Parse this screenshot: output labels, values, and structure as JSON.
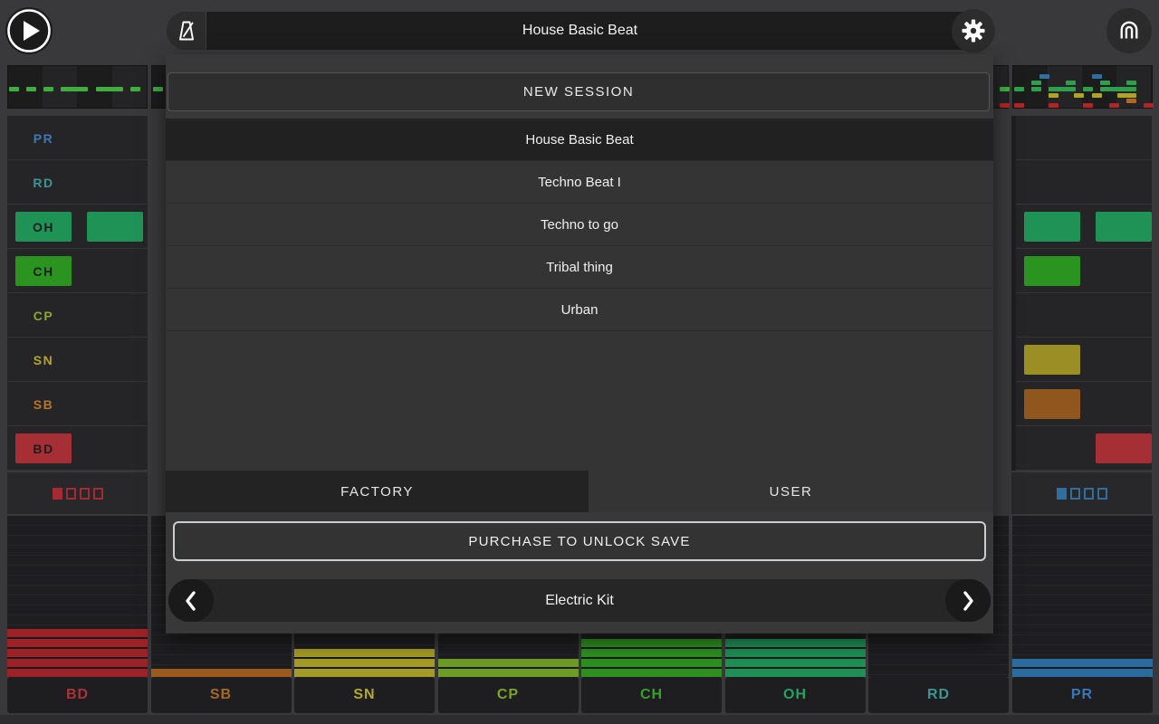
{
  "top_bar": {
    "title": "House Basic Beat",
    "play_icon": "play-icon",
    "metronome_icon": "metronome-icon",
    "settings_icon": "gear-icon",
    "logo_icon": "fingerlab-logo-icon"
  },
  "modal": {
    "new_session_label": "NEW SESSION",
    "sessions": [
      {
        "name": "House Basic Beat",
        "selected": true
      },
      {
        "name": "Techno Beat I",
        "selected": false
      },
      {
        "name": "Techno to go",
        "selected": false
      },
      {
        "name": "Tribal thing",
        "selected": false
      },
      {
        "name": "Urban",
        "selected": false
      }
    ],
    "tabs": [
      {
        "label": "FACTORY",
        "active": true
      },
      {
        "label": "USER",
        "active": false
      }
    ],
    "purchase_label": "PURCHASE TO UNLOCK SAVE",
    "kit_selector": {
      "value": "Electric Kit",
      "left_icon": "chevron-left-icon",
      "right_icon": "chevron-right-icon"
    }
  },
  "tracks": [
    {
      "id": "PR",
      "label": "PR",
      "text_color": "#3c78b4",
      "pad_color": "#2f6ba5",
      "left_col1_pad": false,
      "left_col2_pad": false,
      "right_col1_pad": false,
      "right_col2_pad": false
    },
    {
      "id": "RD",
      "label": "RD",
      "text_color": "#3d9494",
      "pad_color": "#2e8a8a",
      "left_col1_pad": false,
      "left_col2_pad": false,
      "right_col1_pad": false,
      "right_col2_pad": false
    },
    {
      "id": "OH",
      "label": "OH",
      "text_color": "#27a061",
      "pad_color": "#1f9356",
      "left_col1_pad": true,
      "left_col2_pad": true,
      "right_col1_pad": true,
      "right_col2_pad": true
    },
    {
      "id": "CH",
      "label": "CH",
      "text_color": "#39a02c",
      "pad_color": "#2b9320",
      "left_col1_pad": true,
      "left_col2_pad": false,
      "right_col1_pad": true,
      "right_col2_pad": false
    },
    {
      "id": "CP",
      "label": "CP",
      "text_color": "#8aa534",
      "pad_color": "#7da32e",
      "left_col1_pad": false,
      "left_col2_pad": false,
      "right_col1_pad": false,
      "right_col2_pad": false
    },
    {
      "id": "SN",
      "label": "SN",
      "text_color": "#b3a42c",
      "pad_color": "#9a8e24",
      "left_col1_pad": false,
      "left_col2_pad": false,
      "right_col1_pad": true,
      "right_col2_pad": false
    },
    {
      "id": "SB",
      "label": "SB",
      "text_color": "#b5762b",
      "pad_color": "#8f561d",
      "left_col1_pad": false,
      "left_col2_pad": false,
      "right_col1_pad": true,
      "right_col2_pad": false
    },
    {
      "id": "BD",
      "label": "BD",
      "text_color": "#a8333a",
      "pad_color": "#a62f35",
      "left_col1_pad": true,
      "left_col2_pad": false,
      "right_col1_pad": false,
      "right_col2_pad": true
    }
  ],
  "page_indicators": {
    "left": {
      "color": "#a42a33",
      "count": 4,
      "active_index": 0
    },
    "right": {
      "color": "#2f6e9f",
      "count": 4,
      "active_index": 0
    }
  },
  "faders": [
    {
      "label": "BD",
      "color": "#9b2328",
      "text_color": "#a8333a",
      "segments": 5
    },
    {
      "label": "SB",
      "color": "#9a5a1c",
      "text_color": "#a5691f",
      "segments": 1
    },
    {
      "label": "SN",
      "color": "#a59b25",
      "text_color": "#b3a92e",
      "segments": 3
    },
    {
      "label": "CP",
      "color": "#6d9b26",
      "text_color": "#7aa52c",
      "segments": 2
    },
    {
      "label": "CH",
      "color": "#2e8f20",
      "text_color": "#39a02c",
      "segments": 4
    },
    {
      "label": "OH",
      "color": "#1e8f55",
      "text_color": "#27a061",
      "segments": 4
    },
    {
      "label": "RD",
      "color": null,
      "text_color": "#3d9595",
      "segments": 0
    },
    {
      "label": "PR",
      "color": "#2c6b9e",
      "text_color": "#3b77b5",
      "segments": 2
    }
  ],
  "sequence_strip": {
    "rows_y": [
      9,
      16,
      23,
      30,
      36,
      41
    ],
    "sections": [
      {
        "col": 0,
        "dashes": [
          {
            "row": 2,
            "color": "#3fae3f",
            "steps": [
              0,
              2,
              4,
              6,
              7,
              8,
              10,
              11,
              12,
              14
            ]
          }
        ]
      },
      {
        "col": 1,
        "dashes": [
          {
            "row": 2,
            "color": "#3fae3f",
            "steps": [
              0
            ]
          }
        ]
      },
      {
        "col": 6,
        "dashes": [
          {
            "row": 2,
            "color": "#3fae3f",
            "steps": [
              15
            ]
          },
          {
            "row": 5,
            "color": "#b02525",
            "steps": [
              15
            ]
          }
        ]
      },
      {
        "col": 7,
        "dashes": [
          {
            "row": 0,
            "color": "#2f6e9f",
            "steps": [
              3,
              9
            ]
          },
          {
            "row": 1,
            "color": "#2da04c",
            "steps": [
              2,
              6,
              10,
              13
            ]
          },
          {
            "row": 2,
            "color": "#2da04c",
            "steps": [
              0,
              2,
              4,
              5,
              6,
              8,
              10,
              11,
              12,
              13
            ]
          },
          {
            "row": 3,
            "color": "#b0a428",
            "steps": [
              4,
              7,
              9,
              12,
              13
            ]
          },
          {
            "row": 4,
            "color": "#b06a20",
            "steps": [
              13
            ]
          },
          {
            "row": 5,
            "color": "#b02525",
            "steps": [
              0,
              4,
              8,
              11,
              15
            ]
          }
        ]
      }
    ]
  }
}
